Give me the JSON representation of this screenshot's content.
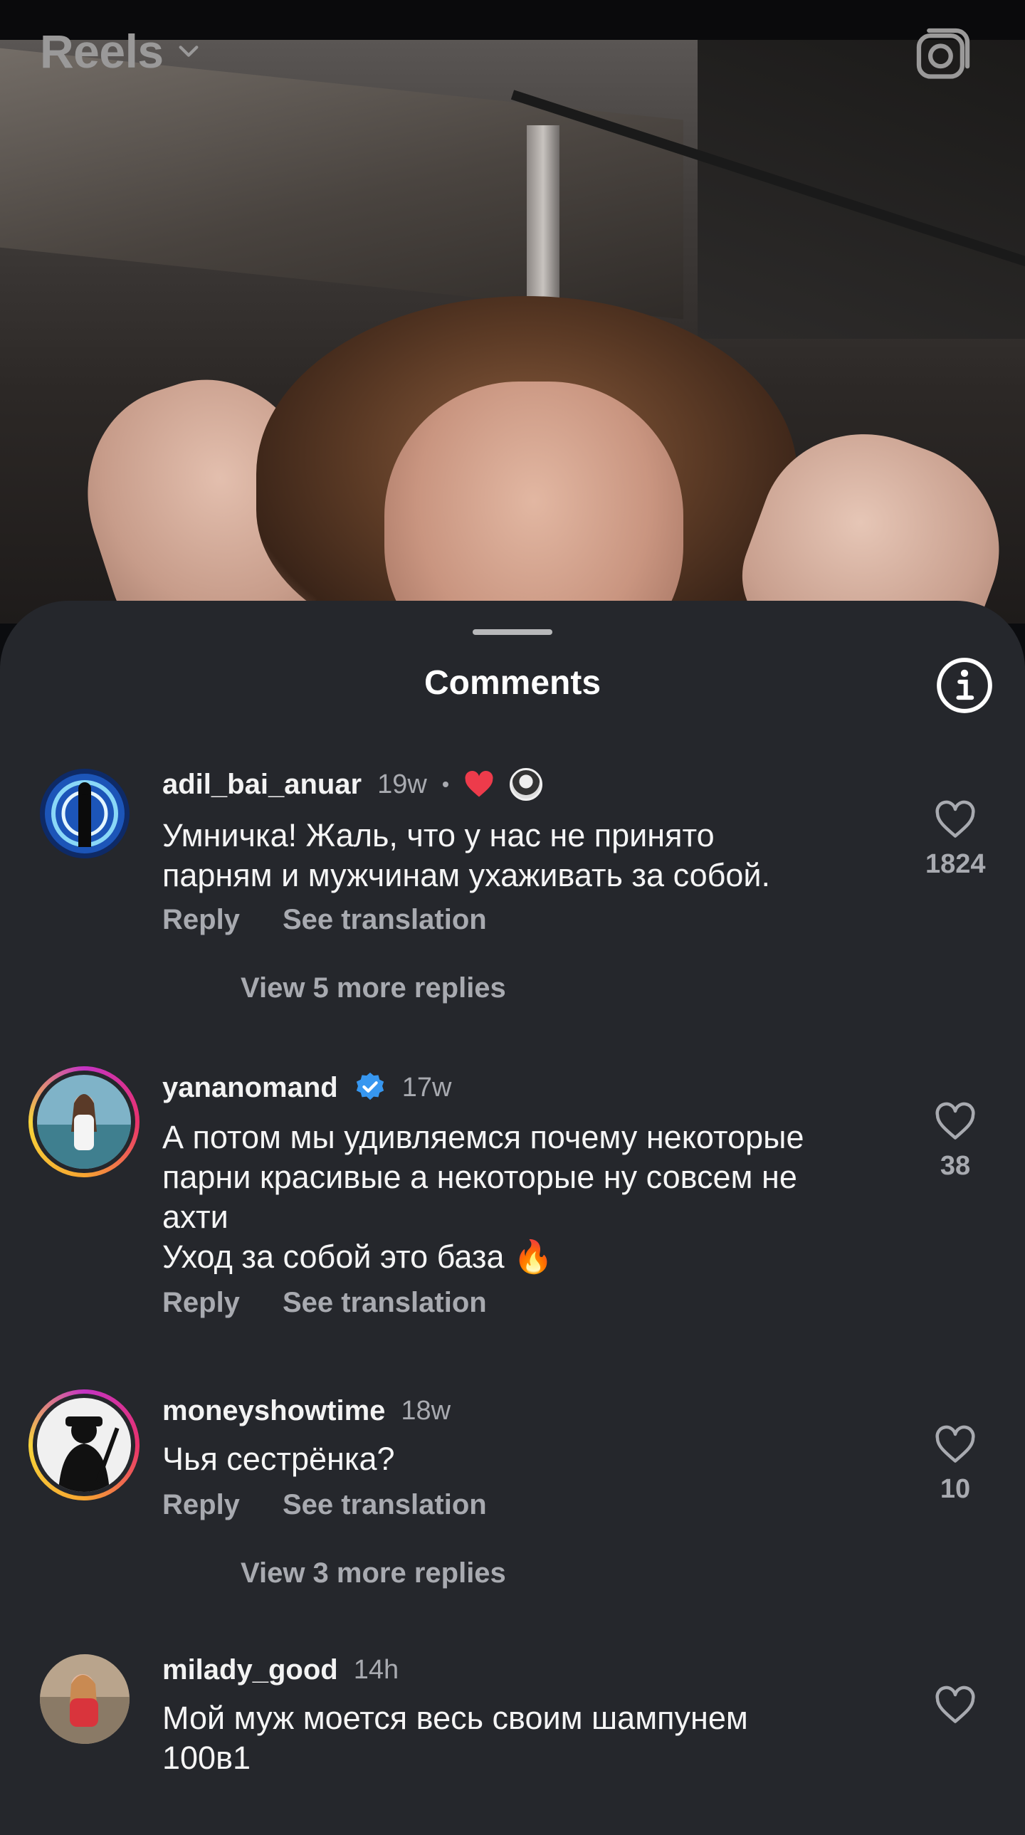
{
  "header": {
    "title": "Reels"
  },
  "sheet": {
    "title": "Comments"
  },
  "comments": [
    {
      "username": "adil_bai_anuar",
      "time": "19w",
      "text": "Умничка! Жаль, что у нас не принято\nпарням и мужчинам ухаживать за собой.",
      "reply_label": "Reply",
      "translate_label": "See translation",
      "view_replies": "View 5 more replies",
      "likes": "1824"
    },
    {
      "username": "yananomand",
      "time": "17w",
      "text": "А потом мы удивляемся почему некоторые\nпарни красивые а некоторые ну совсем не\nахти\nУход за собой это база 🔥",
      "reply_label": "Reply",
      "translate_label": "See translation",
      "likes": "38"
    },
    {
      "username": "moneyshowtime",
      "time": "18w",
      "text": "Чья сестрёнка?",
      "reply_label": "Reply",
      "translate_label": "See translation",
      "view_replies": "View 3 more replies",
      "likes": "10"
    },
    {
      "username": "milady_good",
      "time": "14h",
      "text": "Мой муж моется весь своим шампунем\n100в1"
    }
  ],
  "colors": {
    "sheet_bg": "#25272c",
    "muted_text": "#a8aab0",
    "like_heart": "#ed3b4b",
    "verified_blue": "#3797f0"
  },
  "icons": [
    "chevron-down-icon",
    "camera-icon",
    "info-icon",
    "heart-outline-icon",
    "heart-filled-icon",
    "verified-badge-icon"
  ]
}
